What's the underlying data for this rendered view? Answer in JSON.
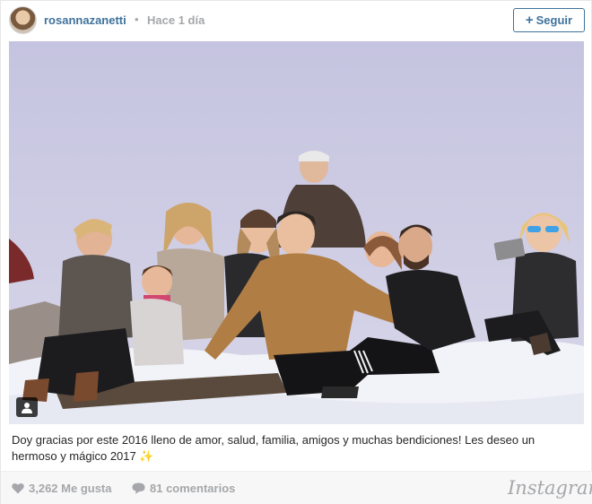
{
  "header": {
    "username": "rosannazanetti",
    "separator": "•",
    "timestamp": "Hace 1 día",
    "follow_button": {
      "icon": "plus-icon",
      "label": "Seguir"
    }
  },
  "photo": {
    "subject": "Group of family members sitting on snow taking a selfie",
    "user_tag_icon": "person-icon"
  },
  "caption": {
    "text": "Doy gracias por este 2016 lleno de amor, salud, familia, amigos y muchas bendiciones! Les deseo un hermoso y mágico 2017 ✨"
  },
  "footer": {
    "likes": {
      "icon": "heart-icon",
      "label": "3,262 Me gusta"
    },
    "comments": {
      "icon": "comment-icon",
      "label": "81 comentarios"
    },
    "brand": "Instagram"
  },
  "colors": {
    "link_blue": "#3f729b",
    "muted_gray": "#a5a7aa",
    "sky": "#c9c9e2",
    "snow": "#f4f6fb"
  }
}
